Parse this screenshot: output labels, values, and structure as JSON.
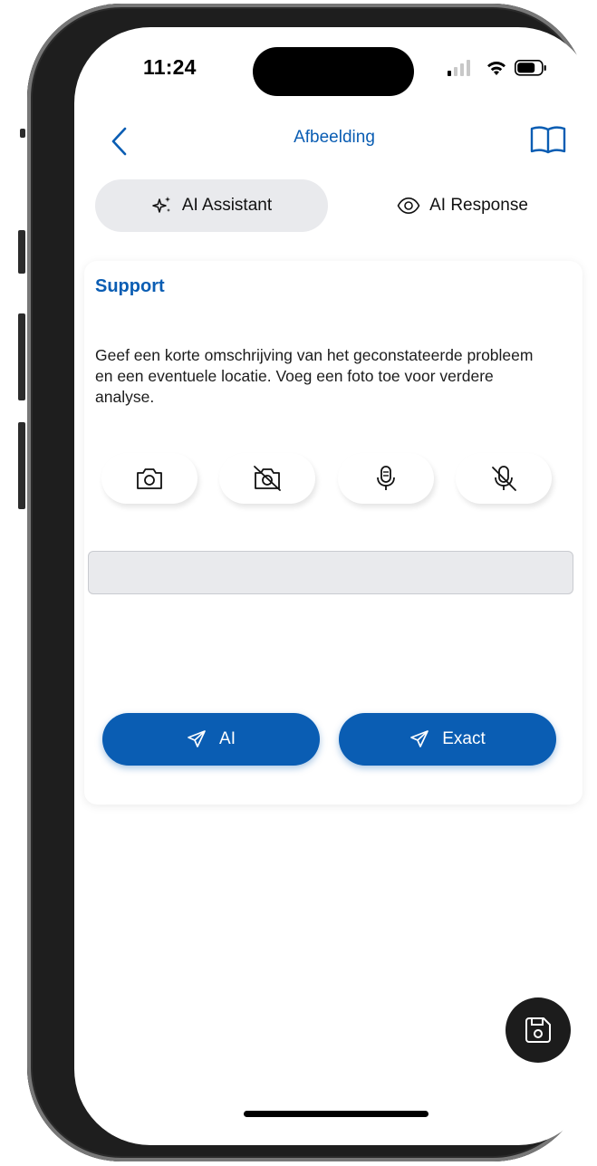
{
  "status_bar": {
    "time": "11:24"
  },
  "header": {
    "title": "Afbeelding"
  },
  "tabs": [
    {
      "label": "AI Assistant",
      "icon": "sparkles-icon",
      "active": true
    },
    {
      "label": "AI Response",
      "icon": "eye-icon",
      "active": false
    }
  ],
  "card": {
    "title": "Support",
    "description": "Geef een korte omschrijving van het geconstateerde probleem en een eventuele locatie. Voeg een foto toe voor verdere analyse.",
    "media_buttons": [
      "camera-icon",
      "camera-off-icon",
      "microphone-icon",
      "microphone-off-icon"
    ],
    "input": {
      "value": "",
      "placeholder": ""
    },
    "send_buttons": [
      {
        "label": "AI",
        "icon": "send-icon"
      },
      {
        "label": "Exact",
        "icon": "send-icon"
      }
    ]
  },
  "fab": {
    "icon": "save-icon"
  },
  "colors": {
    "accent": "#0a5db3",
    "tab_active_bg": "#e9eaed",
    "fab_bg": "#1c1c1c"
  }
}
